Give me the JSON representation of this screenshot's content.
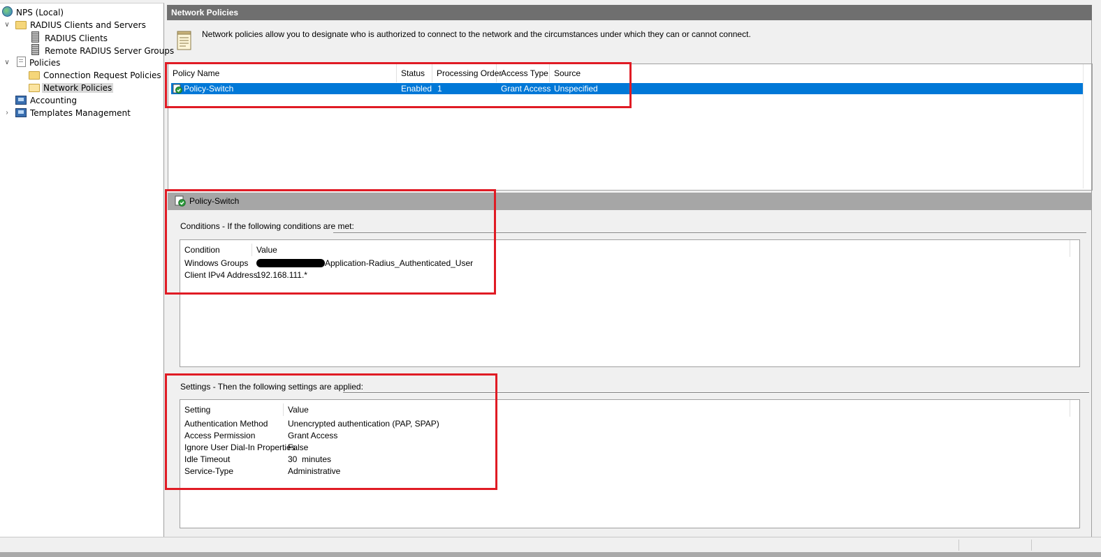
{
  "tree": {
    "root": "NPS (Local)",
    "radius_clients_and_servers": "RADIUS Clients and Servers",
    "radius_clients": "RADIUS Clients",
    "remote_radius_server_groups": "Remote RADIUS Server Groups",
    "policies": "Policies",
    "connection_request_policies": "Connection Request Policies",
    "network_policies": "Network Policies",
    "accounting": "Accounting",
    "templates_management": "Templates Management"
  },
  "header": {
    "title": "Network Policies",
    "description": "Network policies allow you to designate who is authorized to connect to the network and the circumstances under which they can or cannot connect."
  },
  "policy_list": {
    "columns": {
      "name": "Policy Name",
      "status": "Status",
      "order": "Processing Order",
      "access": "Access Type",
      "source": "Source"
    },
    "rows": [
      {
        "name": "Policy-Switch",
        "status": "Enabled",
        "order": "1",
        "access": "Grant Access",
        "source": "Unspecified"
      }
    ]
  },
  "detail": {
    "policy_name": "Policy-Switch",
    "conditions_label": "Conditions - If the following conditions are met:",
    "conditions_columns": {
      "condition": "Condition",
      "value": "Value"
    },
    "conditions": [
      {
        "condition": "Windows Groups",
        "value": "Application-Radius_Authenticated_User"
      },
      {
        "condition": "Client IPv4 Address",
        "value": "192.168.111.*"
      }
    ],
    "settings_label": "Settings - Then the following settings are applied:",
    "settings_columns": {
      "setting": "Setting",
      "value": "Value"
    },
    "settings": [
      {
        "setting": "Authentication Method",
        "value": "Unencrypted authentication (PAP, SPAP)"
      },
      {
        "setting": "Access Permission",
        "value": "Grant Access"
      },
      {
        "setting": "Ignore User Dial-In Properties",
        "value": "False"
      },
      {
        "setting": "Idle Timeout",
        "value": "30  minutes"
      },
      {
        "setting": "Service-Type",
        "value": "Administrative"
      }
    ]
  },
  "icons": {
    "root": "globe-icon",
    "folder": "folder-icon",
    "server": "server-icon",
    "policies": "document-icon",
    "accounting": "computer-icon",
    "templates": "computer-icon",
    "policy": "policy-check-icon",
    "info": "notepad-icon"
  },
  "colors": {
    "selection": "#0078d7",
    "title_bar": "#6f6f6f",
    "detail_header": "#a6a6a6",
    "highlight_box": "#e01b24"
  }
}
